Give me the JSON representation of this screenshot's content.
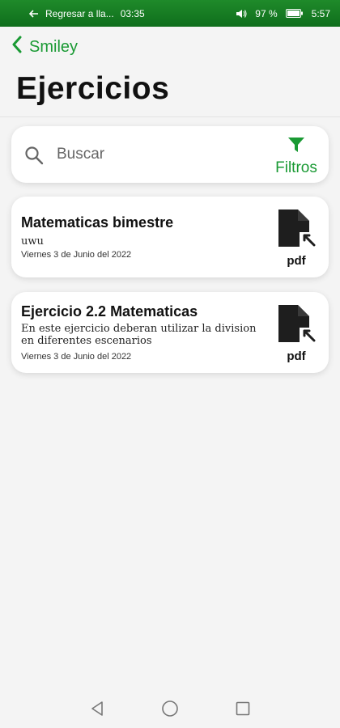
{
  "status_bar": {
    "back_to_call": "Regresar a lla...",
    "call_time": "03:35",
    "battery": "97 %",
    "time": "5:57"
  },
  "nav": {
    "back_label": "Smiley"
  },
  "page": {
    "title": "Ejercicios"
  },
  "search": {
    "placeholder": "Buscar",
    "filter_label": "Filtros"
  },
  "exercises": [
    {
      "title": "Matematicas bimestre",
      "description": "uwu",
      "date": "Viernes 3 de Junio del 2022",
      "file_label": "pdf"
    },
    {
      "title": "Ejercicio 2.2 Matematicas",
      "description": "En este ejercicio deberan utilizar la division en diferentes escenarios",
      "date": "Viernes 3 de Junio del 2022",
      "file_label": "pdf"
    }
  ],
  "colors": {
    "accent": "#1a9a34",
    "status_bar": "#138021",
    "background": "#f4f4f4"
  },
  "icons": [
    "back-arrow-icon",
    "chevron-left-icon",
    "volume-icon",
    "battery-icon",
    "search-icon",
    "filter-icon",
    "pdf-file-icon",
    "back-triangle-icon",
    "home-circle-icon",
    "recents-square-icon"
  ]
}
